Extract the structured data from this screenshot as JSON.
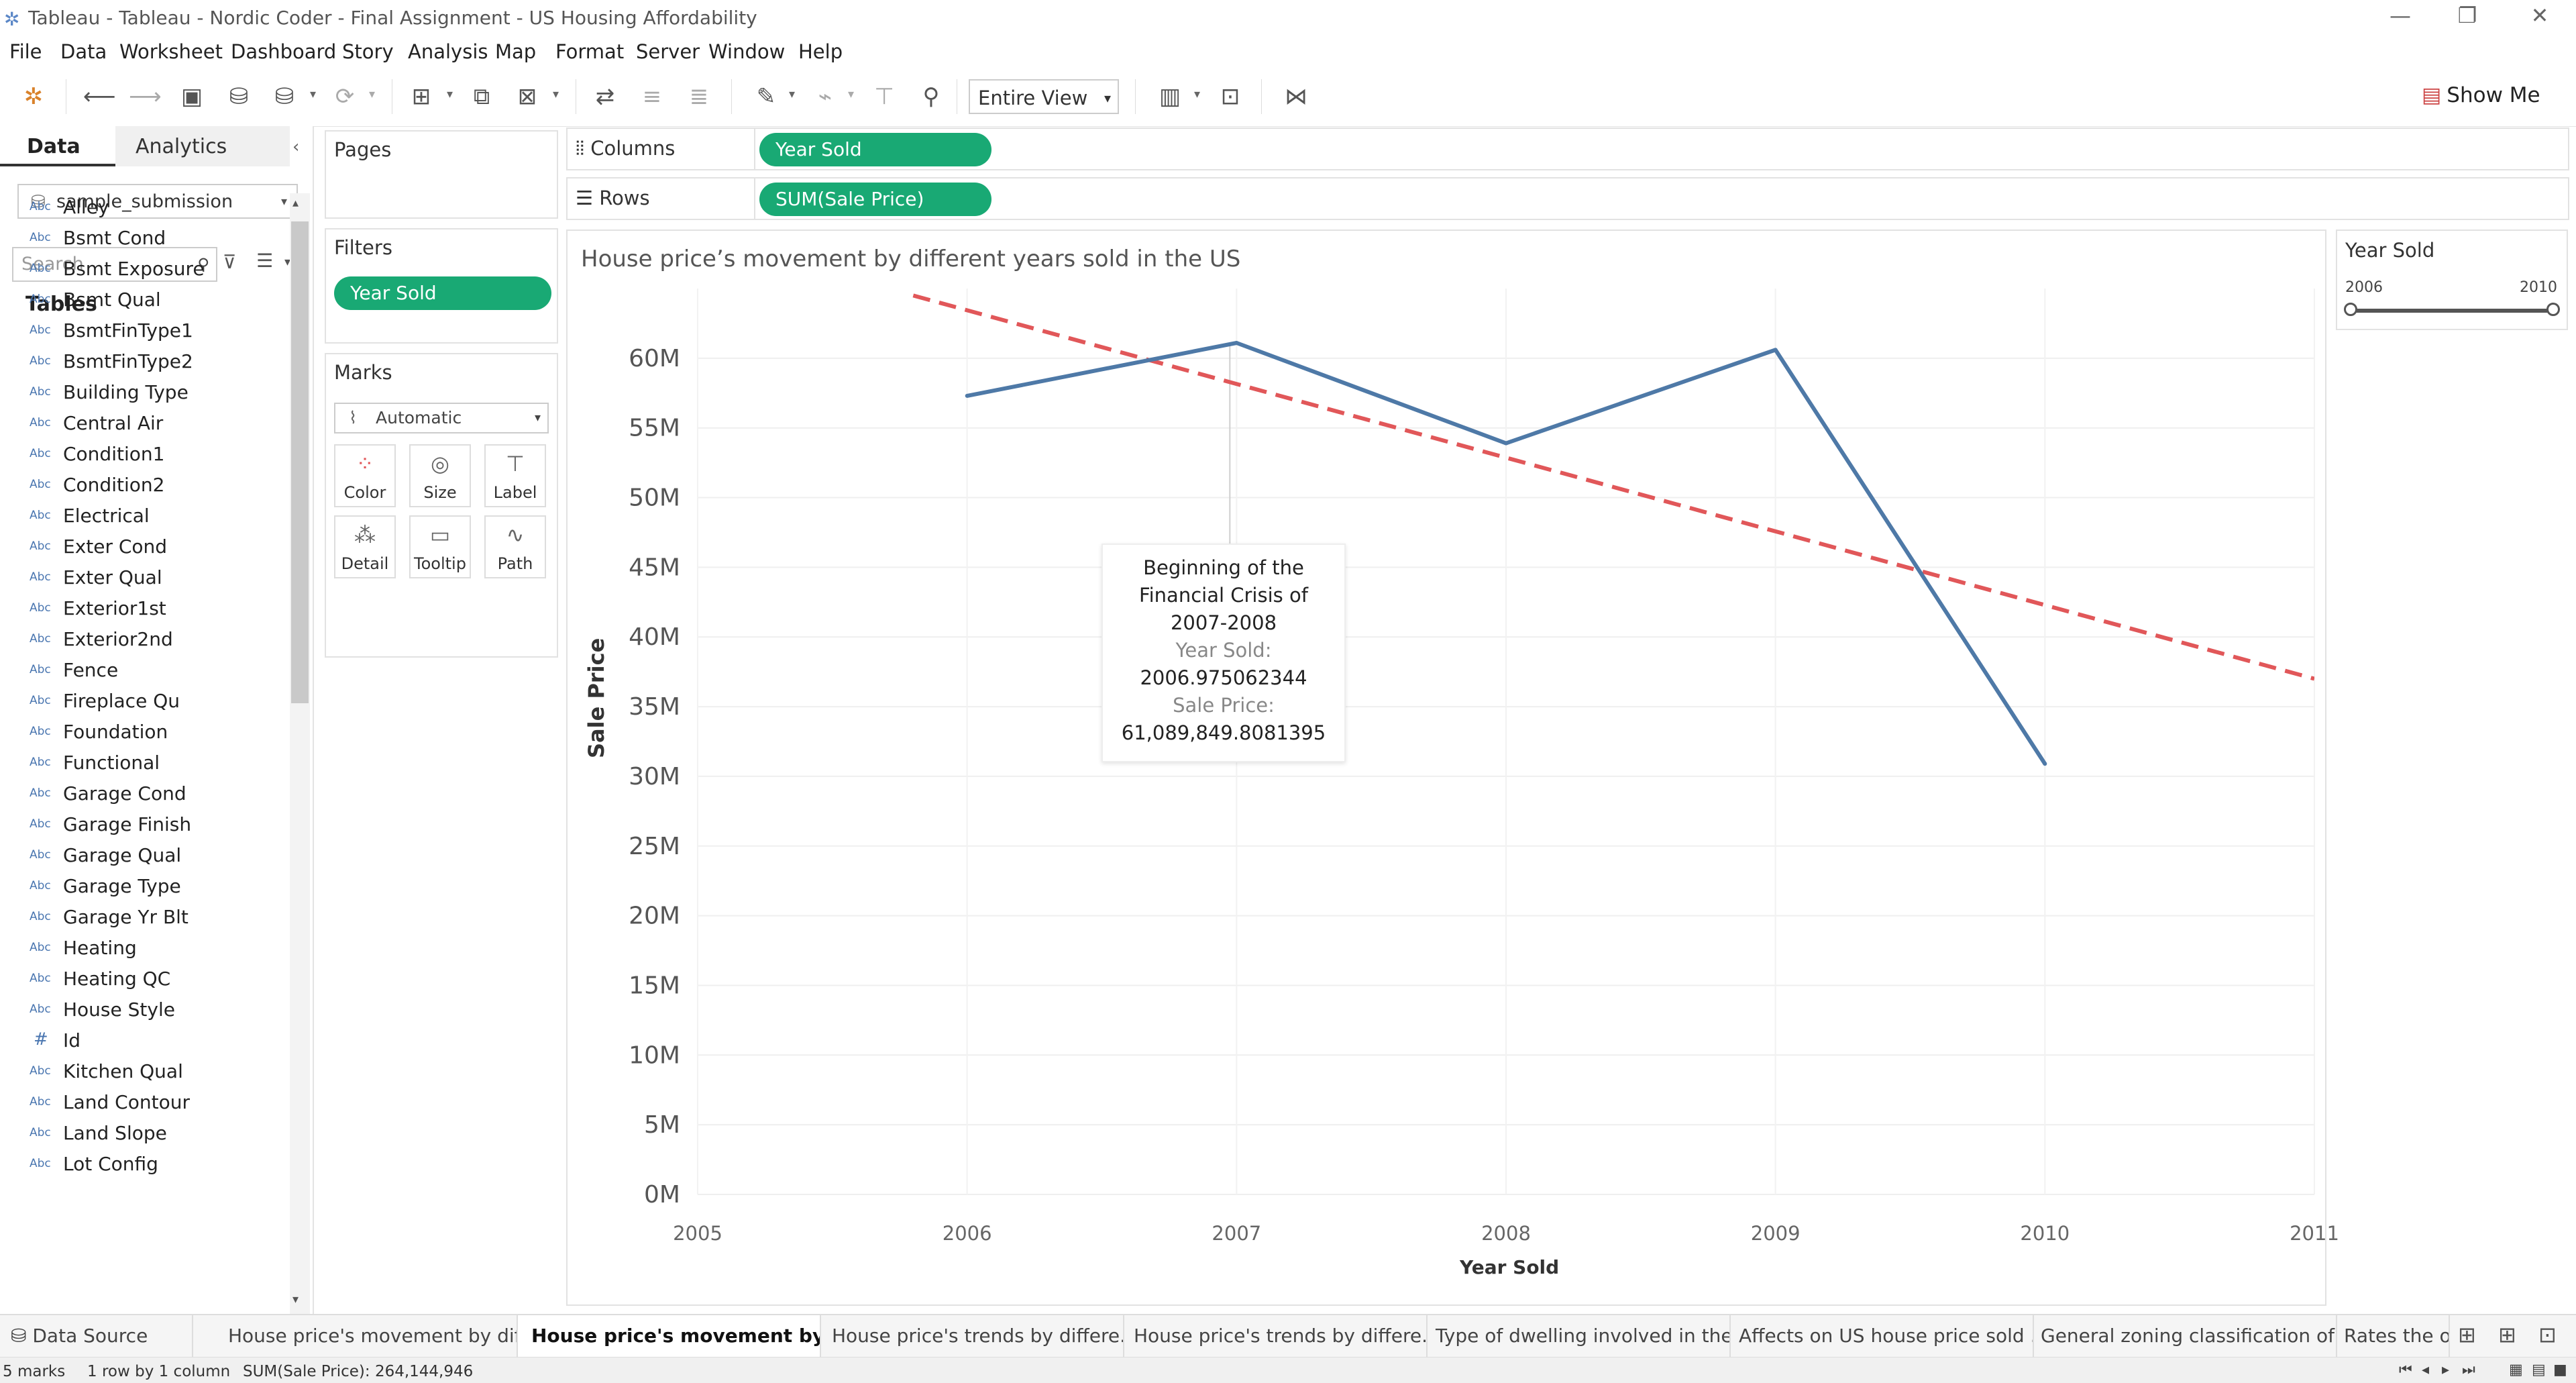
{
  "window": {
    "title": "Tableau - Tableau - Nordic Coder - Final Assignment - US Housing Affordability",
    "controls": [
      "—",
      "❐",
      "✕"
    ]
  },
  "menu": [
    "File",
    "Data",
    "Worksheet",
    "Dashboard",
    "Story",
    "Analysis",
    "Map",
    "Format",
    "Server",
    "Window",
    "Help"
  ],
  "toolbar": {
    "fit_label": "Entire View",
    "show_me_label": "Show Me",
    "icons": [
      "tableau-logo-icon",
      "back-icon",
      "forward-icon",
      "save-icon",
      "new-datasource-icon",
      "pause-updates-icon",
      "refresh-icon",
      "new-worksheet-icon",
      "duplicate-sheet-icon",
      "clear-sheet-icon",
      "swap-icon",
      "sort-ascending-icon",
      "sort-descending-icon",
      "highlight-icon",
      "group-icon",
      "label-icon",
      "pin-icon",
      "fit-icon",
      "presentation-icon",
      "share-icon"
    ]
  },
  "data_pane": {
    "tab_data": "Data",
    "tab_analytics": "Analytics",
    "datasource": "sample_submission",
    "search_placeholder": "Search",
    "tables_header": "Tables",
    "fields": [
      {
        "type": "Abc",
        "name": "Alley"
      },
      {
        "type": "Abc",
        "name": "Bsmt Cond"
      },
      {
        "type": "Abc",
        "name": "Bsmt Exposure"
      },
      {
        "type": "Abc",
        "name": "Bsmt Qual"
      },
      {
        "type": "Abc",
        "name": "BsmtFinType1"
      },
      {
        "type": "Abc",
        "name": "BsmtFinType2"
      },
      {
        "type": "Abc",
        "name": "Building Type"
      },
      {
        "type": "Abc",
        "name": "Central Air"
      },
      {
        "type": "Abc",
        "name": "Condition1"
      },
      {
        "type": "Abc",
        "name": "Condition2"
      },
      {
        "type": "Abc",
        "name": "Electrical"
      },
      {
        "type": "Abc",
        "name": "Exter Cond"
      },
      {
        "type": "Abc",
        "name": "Exter Qual"
      },
      {
        "type": "Abc",
        "name": "Exterior1st"
      },
      {
        "type": "Abc",
        "name": "Exterior2nd"
      },
      {
        "type": "Abc",
        "name": "Fence"
      },
      {
        "type": "Abc",
        "name": "Fireplace Qu"
      },
      {
        "type": "Abc",
        "name": "Foundation"
      },
      {
        "type": "Abc",
        "name": "Functional"
      },
      {
        "type": "Abc",
        "name": "Garage Cond"
      },
      {
        "type": "Abc",
        "name": "Garage Finish"
      },
      {
        "type": "Abc",
        "name": "Garage Qual"
      },
      {
        "type": "Abc",
        "name": "Garage Type"
      },
      {
        "type": "Abc",
        "name": "Garage Yr Blt"
      },
      {
        "type": "Abc",
        "name": "Heating"
      },
      {
        "type": "Abc",
        "name": "Heating QC"
      },
      {
        "type": "Abc",
        "name": "House Style"
      },
      {
        "type": "#",
        "name": "Id"
      },
      {
        "type": "Abc",
        "name": "Kitchen Qual"
      },
      {
        "type": "Abc",
        "name": "Land Contour"
      },
      {
        "type": "Abc",
        "name": "Land Slope"
      },
      {
        "type": "Abc",
        "name": "Lot Config"
      }
    ]
  },
  "shelves": {
    "pages_label": "Pages",
    "filters_label": "Filters",
    "filter_pill": "Year Sold",
    "marks_label": "Marks",
    "mark_type": "Automatic",
    "mark_buttons": [
      "Color",
      "Size",
      "Label",
      "Detail",
      "Tooltip",
      "Path"
    ],
    "columns_label": "Columns",
    "columns_pill": "Year Sold",
    "rows_label": "Rows",
    "rows_pill": "SUM(Sale Price)"
  },
  "chart_data": {
    "type": "line",
    "title": "House price’s movement by different years sold in the US",
    "xlabel": "Year Sold",
    "ylabel": "Sale Price",
    "xlim": [
      2005,
      2011
    ],
    "ylim": [
      0,
      65000000
    ],
    "x_ticks": [
      "2005",
      "2006",
      "2007",
      "2008",
      "2009",
      "2010",
      "2011"
    ],
    "y_ticks": [
      "0M",
      "5M",
      "10M",
      "15M",
      "20M",
      "25M",
      "30M",
      "35M",
      "40M",
      "45M",
      "50M",
      "55M",
      "60M"
    ],
    "series": [
      {
        "x": [
          2006,
          2007,
          2008,
          2009,
          2010
        ],
        "values": [
          57300000,
          61100000,
          53900000,
          60600000,
          30900000
        ],
        "color": "#4e79a7"
      }
    ],
    "trend_line": {
      "x": [
        2005.8,
        2011
      ],
      "values": [
        64500000,
        37000000
      ],
      "color": "#e15759",
      "style": "dashed"
    },
    "reference_x": 2006.975062344,
    "grid": true,
    "annotation": {
      "title_lines": [
        "Beginning of the",
        "Financial Crisis of",
        "2007-2008"
      ],
      "year_label": "Year Sold:",
      "year_value": "2006.975062344",
      "price_label": "Sale Price:",
      "price_value": "61,089,849.8081395"
    }
  },
  "year_sold_filter": {
    "title": "Year Sold",
    "min": "2006",
    "max": "2010"
  },
  "sheet_tabs": [
    {
      "label": "Data Source",
      "active": false
    },
    {
      "label": "House price's movement by dif...",
      "active": false
    },
    {
      "label": "House price's movement by di...",
      "active": true
    },
    {
      "label": "House price's trends by differe...",
      "active": false
    },
    {
      "label": "House price's trends by differe...",
      "active": false
    },
    {
      "label": "Type of dwelling involved in the ...",
      "active": false
    },
    {
      "label": "Affects on US house price sold ...",
      "active": false
    },
    {
      "label": "General zoning classification of ...",
      "active": false
    },
    {
      "label": "Rates the ov",
      "active": false
    }
  ],
  "status": {
    "marks": "5 marks",
    "rows_cols": "1 row by 1 column",
    "sum": "SUM(Sale Price): 264,144,946"
  },
  "colors": {
    "pill_green": "#19a974",
    "line_blue": "#4e79a7",
    "trend_red": "#e15759"
  }
}
